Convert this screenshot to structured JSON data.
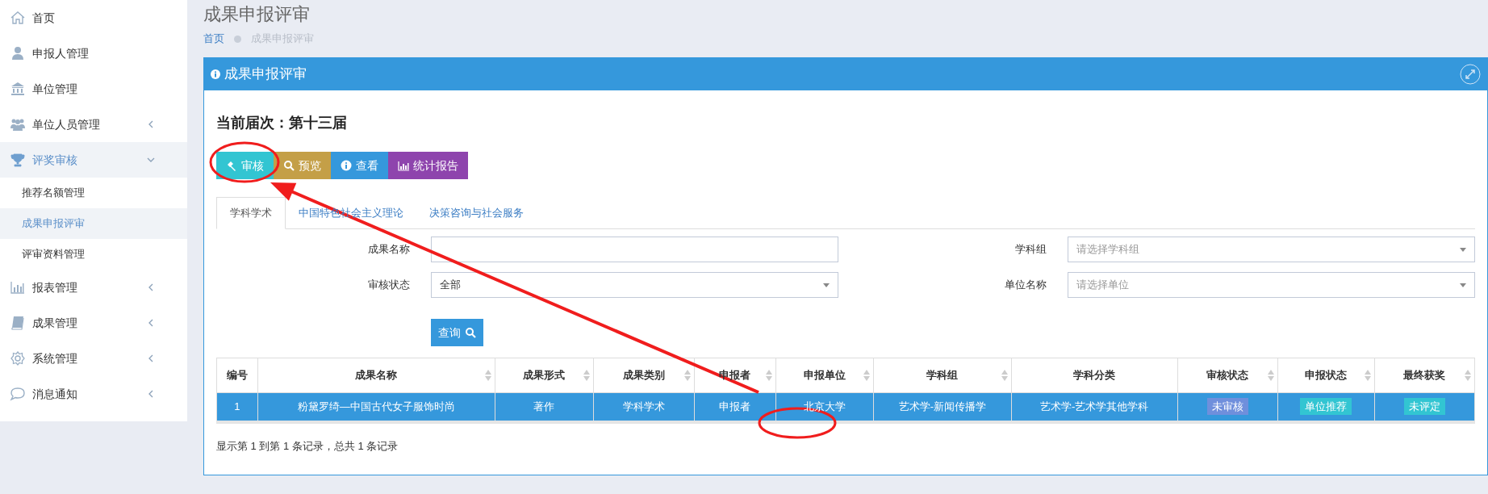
{
  "sidebar": {
    "items": [
      {
        "label": "首页",
        "selected": false
      },
      {
        "label": "申报人管理",
        "selected": false
      },
      {
        "label": "单位管理",
        "selected": false
      },
      {
        "label": "单位人员管理",
        "selected": false,
        "expanded": false
      },
      {
        "label": "评奖审核",
        "selected": false,
        "expanded": true,
        "children": [
          {
            "label": "推荐名额管理",
            "selected": false
          },
          {
            "label": "成果申报评审",
            "selected": true
          },
          {
            "label": "评审资料管理",
            "selected": false
          }
        ]
      },
      {
        "label": "报表管理",
        "selected": false,
        "expanded": false
      },
      {
        "label": "成果管理",
        "selected": false,
        "expanded": false
      },
      {
        "label": "系统管理",
        "selected": false,
        "expanded": false
      },
      {
        "label": "消息通知",
        "selected": false,
        "expanded": false
      }
    ]
  },
  "page_title": "成果申报评审",
  "breadcrumb": [
    "首页",
    "成果申报评审"
  ],
  "panel": {
    "title": "成果申报评审",
    "session": "当前届次：第十三届",
    "actions": [
      {
        "label": "审核",
        "color": "#32c5d2"
      },
      {
        "label": "预览",
        "color": "#c49f47"
      },
      {
        "label": "查看",
        "color": "#3598dc"
      },
      {
        "label": "统计报告",
        "color": "#8e44ad"
      }
    ],
    "tabs": [
      {
        "label": "学科学术",
        "selected": true
      },
      {
        "label": "中国特色社会主义理论",
        "selected": false
      },
      {
        "label": "决策咨询与社会服务",
        "selected": false
      }
    ],
    "filters": [
      {
        "label": "成果名称",
        "kind": "text"
      },
      {
        "label": "学科组",
        "kind": "select",
        "placeholder": "请选择学科组"
      },
      {
        "label": "审核状态",
        "kind": "select",
        "value": "全部"
      },
      {
        "label": "单位名称",
        "kind": "select",
        "placeholder": "请选择单位"
      }
    ],
    "query_button": "查询",
    "table": {
      "columns": [
        {
          "label": "编号",
          "sortable": false
        },
        {
          "label": "成果名称",
          "sortable": true
        },
        {
          "label": "成果形式",
          "sortable": true
        },
        {
          "label": "成果类别",
          "sortable": true
        },
        {
          "label": "申报者",
          "sortable": true
        },
        {
          "label": "申报单位",
          "sortable": true
        },
        {
          "label": "学科组",
          "sortable": true
        },
        {
          "label": "学科分类",
          "sortable": false
        },
        {
          "label": "审核状态",
          "sortable": true
        },
        {
          "label": "申报状态",
          "sortable": true
        },
        {
          "label": "最终获奖",
          "sortable": true
        }
      ],
      "rows": [
        {
          "selected": true,
          "cells": [
            {
              "text": "1"
            },
            {
              "text": "粉黛罗绮—中国古代女子服饰时尚"
            },
            {
              "text": "著作"
            },
            {
              "text": "学科学术"
            },
            {
              "text": "申报者"
            },
            {
              "text": "北京大学"
            },
            {
              "text": "艺术学-新闻传播学"
            },
            {
              "text": "艺术学-艺术学其他学科"
            },
            {
              "text": "未审核",
              "color": "#6f8fdc"
            },
            {
              "text": "单位推荐",
              "color": "#32c5d2"
            },
            {
              "text": "未评定",
              "color": "#32c5d2"
            }
          ]
        }
      ]
    },
    "pagination_info": "显示第 1 到第 1 条记录，总共 1 条记录"
  }
}
